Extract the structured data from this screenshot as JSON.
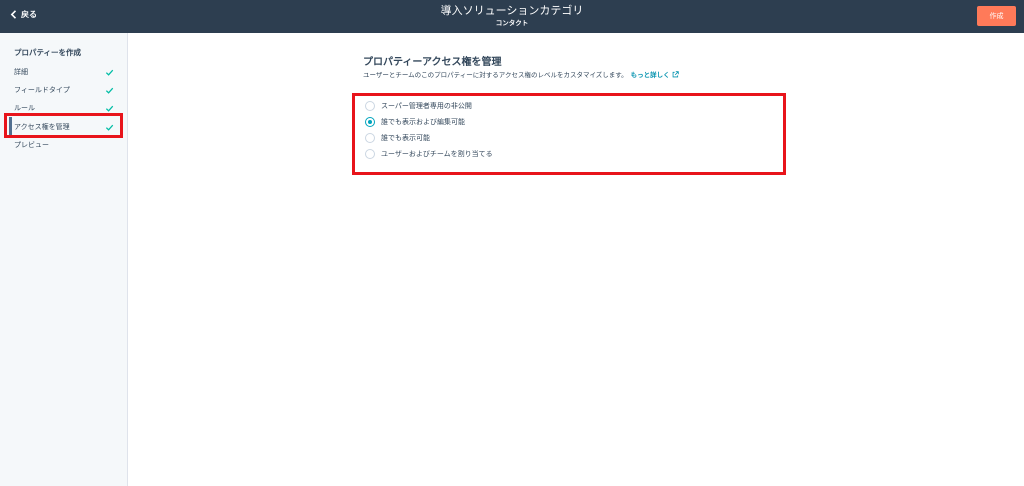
{
  "header": {
    "back_label": "戻る",
    "title": "導入ソリューションカテゴリ",
    "subtitle": "コンタクト",
    "create_label": "作成"
  },
  "sidebar": {
    "heading": "プロパティーを作成",
    "items": [
      {
        "label": "詳細",
        "completed": true
      },
      {
        "label": "フィールドタイプ",
        "completed": true
      },
      {
        "label": "ルール",
        "completed": true
      },
      {
        "label": "アクセス権を管理",
        "completed": true,
        "active": true
      },
      {
        "label": "プレビュー",
        "completed": false
      }
    ]
  },
  "main": {
    "title": "プロパティーアクセス権を管理",
    "description": "ユーザーとチームのこのプロパティーに対するアクセス権のレベルをカスタマイズします。",
    "learn_more": "もっと詳しく",
    "options": [
      {
        "label": "スーパー管理者専用の非公開",
        "selected": false
      },
      {
        "label": "誰でも表示および編集可能",
        "selected": true
      },
      {
        "label": "誰でも表示可能",
        "selected": false
      },
      {
        "label": "ユーザーおよびチームを割り当てる",
        "selected": false
      }
    ]
  },
  "colors": {
    "header_bg": "#2d3e50",
    "accent_orange": "#ff7a59",
    "check_green": "#00bda5",
    "radio_teal": "#00a4bd",
    "highlight_red": "#e8141b"
  },
  "icons": {
    "back": "chevron-left-icon",
    "check": "checkmark-icon",
    "external": "external-link-icon"
  }
}
